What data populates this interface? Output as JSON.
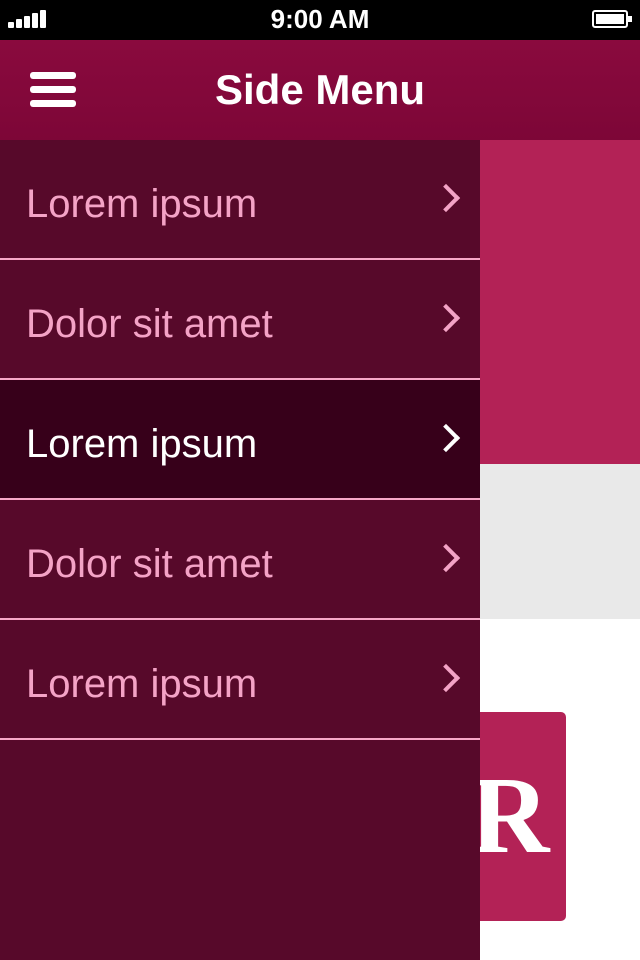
{
  "status_bar": {
    "time": "9:00 AM"
  },
  "nav_bar": {
    "title": "Side Menu",
    "menu_icon": "hamburger-icon"
  },
  "side_menu": {
    "items": [
      {
        "label": "Lorem ipsum",
        "active": false
      },
      {
        "label": "Dolor sit amet",
        "active": false
      },
      {
        "label": "Lorem ipsum",
        "active": true
      },
      {
        "label": "Dolor sit amet",
        "active": false
      },
      {
        "label": "Lorem ipsum",
        "active": false
      }
    ]
  },
  "background_content": {
    "card_letter": "R"
  },
  "colors": {
    "nav": "#850839",
    "menu_bg": "#57092a",
    "menu_active": "#37001a",
    "menu_text": "#f4a3c6",
    "accent": "#b32256"
  }
}
